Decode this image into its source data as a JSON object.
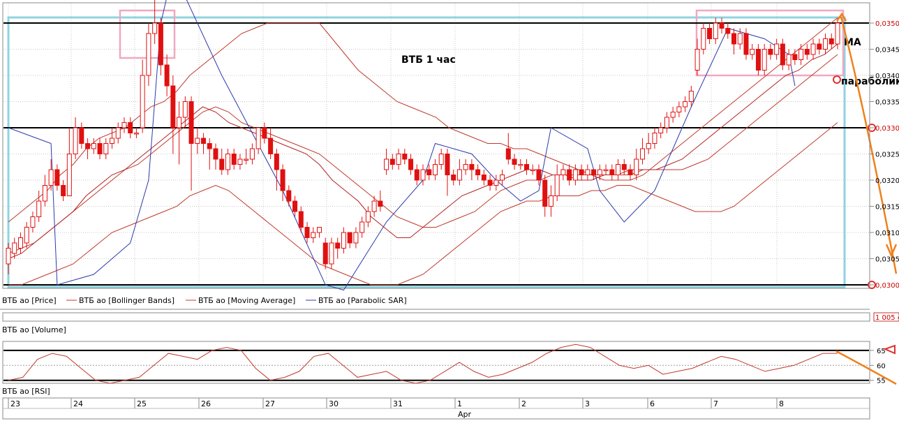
{
  "chart_data": {
    "type": "candlestick",
    "title": "ВТБ   1 час",
    "annotations": {
      "ma": "MA",
      "parabolic": "параболик"
    },
    "x_dates": [
      "23",
      "24",
      "25",
      "26",
      "27",
      "30",
      "31",
      "1",
      "2",
      "3",
      "6",
      "7",
      "8"
    ],
    "x_month_label": "Apr",
    "price_axis": {
      "ylim": [
        0.0298,
        0.0354
      ],
      "ticks": [
        "0,0350",
        "0,0345",
        "0,0340",
        "0,0335",
        "0,0330",
        "0,0325",
        "0,0320",
        "0,0315",
        "0,0310",
        "0,0305",
        "0,0300"
      ],
      "tick_values": [
        0.035,
        0.0345,
        0.034,
        0.0335,
        0.033,
        0.0325,
        0.032,
        0.0315,
        0.031,
        0.0305,
        0.03
      ],
      "horizontal_levels": [
        0.035,
        0.033,
        0.03
      ]
    },
    "legend": [
      "ВТБ ао [Price]",
      "ВТБ ао [Bollinger Bands]",
      "ВТБ ао [Moving Average]",
      "ВТБ ао [Parabolic SAR]"
    ],
    "volume_panel": {
      "label": "ВТБ ао [Volume]",
      "last_value": "1 005 4"
    },
    "rsi_panel": {
      "label": "ВТБ ао [RSI]",
      "ylim": [
        54,
        68
      ],
      "ticks": [
        "65",
        "60",
        "55"
      ],
      "tick_values": [
        65,
        60,
        55
      ],
      "levels": [
        65,
        55
      ]
    },
    "candles": [
      [
        0.0304,
        0.0307,
        0.0302,
        0.0308
      ],
      [
        0.0306,
        0.0308,
        0.0305,
        0.0309
      ],
      [
        0.0307,
        0.0309,
        0.0306,
        0.031
      ],
      [
        0.0308,
        0.0311,
        0.0307,
        0.0312
      ],
      [
        0.0311,
        0.0313,
        0.031,
        0.0314
      ],
      [
        0.0313,
        0.0316,
        0.0312,
        0.0318
      ],
      [
        0.0316,
        0.0319,
        0.0315,
        0.0321
      ],
      [
        0.0319,
        0.0322,
        0.0318,
        0.0324
      ],
      [
        0.0322,
        0.0319,
        0.0318,
        0.0323
      ],
      [
        0.0319,
        0.0317,
        0.0316,
        0.032
      ],
      [
        0.0317,
        0.0325,
        0.0317,
        0.033
      ],
      [
        0.0325,
        0.033,
        0.0324,
        0.0332
      ],
      [
        0.033,
        0.0327,
        0.0326,
        0.0331
      ],
      [
        0.0327,
        0.0326,
        0.0324,
        0.0328
      ],
      [
        0.0326,
        0.0327,
        0.0325,
        0.0328
      ],
      [
        0.0327,
        0.0325,
        0.0324,
        0.0328
      ],
      [
        0.0325,
        0.0327,
        0.0324,
        0.0328
      ],
      [
        0.0327,
        0.0328,
        0.0326,
        0.033
      ],
      [
        0.0328,
        0.033,
        0.0327,
        0.0331
      ],
      [
        0.033,
        0.0331,
        0.0329,
        0.0332
      ],
      [
        0.0331,
        0.0329,
        0.0328,
        0.0332
      ],
      [
        0.0329,
        0.0329,
        0.0328,
        0.033
      ],
      [
        0.033,
        0.034,
        0.0329,
        0.0343
      ],
      [
        0.034,
        0.0348,
        0.0338,
        0.035
      ],
      [
        0.0348,
        0.035,
        0.0346,
        0.0355
      ],
      [
        0.035,
        0.0342,
        0.034,
        0.0351
      ],
      [
        0.0342,
        0.0338,
        0.0336,
        0.0344
      ],
      [
        0.0338,
        0.033,
        0.0325,
        0.034
      ],
      [
        0.033,
        0.0332,
        0.0323,
        0.0335
      ],
      [
        0.0332,
        0.0335,
        0.033,
        0.0336
      ],
      [
        0.0335,
        0.0327,
        0.0318,
        0.0336
      ],
      [
        0.0327,
        0.0328,
        0.0325,
        0.033
      ],
      [
        0.0328,
        0.0327,
        0.0325,
        0.0329
      ],
      [
        0.0327,
        0.0326,
        0.0322,
        0.0328
      ],
      [
        0.0326,
        0.0324,
        0.0322,
        0.0327
      ],
      [
        0.0324,
        0.0322,
        0.0321,
        0.0326
      ],
      [
        0.0322,
        0.0325,
        0.0321,
        0.0326
      ],
      [
        0.0325,
        0.0323,
        0.0322,
        0.0326
      ],
      [
        0.0323,
        0.0324,
        0.0322,
        0.0325
      ],
      [
        0.0324,
        0.0324,
        0.0323,
        0.0326
      ],
      [
        0.0324,
        0.0326,
        0.0323,
        0.0327
      ],
      [
        0.0326,
        0.033,
        0.0325,
        0.033
      ],
      [
        0.033,
        0.0328,
        0.0327,
        0.0331
      ],
      [
        0.0328,
        0.0325,
        0.0324,
        0.033
      ],
      [
        0.0325,
        0.0322,
        0.0318,
        0.0326
      ],
      [
        0.0322,
        0.0318,
        0.0316,
        0.0323
      ],
      [
        0.0318,
        0.0316,
        0.0315,
        0.0319
      ],
      [
        0.0316,
        0.0314,
        0.0313,
        0.0317
      ],
      [
        0.0314,
        0.0311,
        0.031,
        0.0315
      ],
      [
        0.0311,
        0.0309,
        0.0308,
        0.0312
      ],
      [
        0.0309,
        0.031,
        0.0308,
        0.0311
      ],
      [
        0.031,
        0.0311,
        0.0309,
        0.0311
      ],
      [
        0.0308,
        0.0304,
        0.0303,
        0.0309
      ],
      [
        0.0304,
        0.0308,
        0.0303,
        0.0309
      ],
      [
        0.0308,
        0.0307,
        0.0305,
        0.0309
      ],
      [
        0.0307,
        0.031,
        0.0306,
        0.0311
      ],
      [
        0.031,
        0.0308,
        0.0307,
        0.031
      ],
      [
        0.0308,
        0.031,
        0.0307,
        0.0311
      ],
      [
        0.031,
        0.0312,
        0.0309,
        0.0313
      ],
      [
        0.0312,
        0.0314,
        0.0311,
        0.0315
      ],
      [
        0.0314,
        0.0316,
        0.0313,
        0.0317
      ],
      [
        0.0316,
        0.0315,
        0.0314,
        0.0318
      ],
      [
        0.0322,
        0.0324,
        0.0321,
        0.0326
      ],
      [
        0.0324,
        0.0323,
        0.0322,
        0.0325
      ],
      [
        0.0323,
        0.0325,
        0.0322,
        0.0326
      ],
      [
        0.0325,
        0.0324,
        0.0323,
        0.0326
      ],
      [
        0.0324,
        0.0322,
        0.0321,
        0.0325
      ],
      [
        0.0322,
        0.032,
        0.0319,
        0.0323
      ],
      [
        0.032,
        0.0322,
        0.0319,
        0.0323
      ],
      [
        0.0322,
        0.0321,
        0.032,
        0.0323
      ],
      [
        0.0321,
        0.0323,
        0.032,
        0.0324
      ],
      [
        0.0323,
        0.0325,
        0.0322,
        0.0326
      ],
      [
        0.0325,
        0.0321,
        0.0317,
        0.0326
      ],
      [
        0.0321,
        0.032,
        0.0319,
        0.0322
      ],
      [
        0.032,
        0.0322,
        0.0319,
        0.0324
      ],
      [
        0.0322,
        0.0323,
        0.0321,
        0.0324
      ],
      [
        0.0323,
        0.0322,
        0.032,
        0.0324
      ],
      [
        0.0322,
        0.0321,
        0.032,
        0.0323
      ],
      [
        0.0321,
        0.032,
        0.0319,
        0.0322
      ],
      [
        0.032,
        0.0319,
        0.0318,
        0.0321
      ],
      [
        0.0319,
        0.032,
        0.0318,
        0.0321
      ],
      [
        0.032,
        0.0321,
        0.0319,
        0.0322
      ],
      [
        0.0326,
        0.0324,
        0.0323,
        0.0329
      ],
      [
        0.0324,
        0.0323,
        0.0322,
        0.0325
      ],
      [
        0.0323,
        0.0323,
        0.0322,
        0.0324
      ],
      [
        0.0323,
        0.0322,
        0.0321,
        0.0324
      ],
      [
        0.0322,
        0.0322,
        0.0321,
        0.0323
      ],
      [
        0.0322,
        0.032,
        0.0319,
        0.0323
      ],
      [
        0.032,
        0.0315,
        0.0313,
        0.0321
      ],
      [
        0.0315,
        0.0317,
        0.0313,
        0.0319
      ],
      [
        0.0317,
        0.0321,
        0.0316,
        0.0323
      ],
      [
        0.0321,
        0.0322,
        0.032,
        0.0323
      ],
      [
        0.0322,
        0.032,
        0.0319,
        0.0323
      ],
      [
        0.032,
        0.0322,
        0.0319,
        0.0323
      ],
      [
        0.0322,
        0.0321,
        0.032,
        0.0323
      ],
      [
        0.0321,
        0.0322,
        0.032,
        0.0323
      ],
      [
        0.0322,
        0.0321,
        0.032,
        0.0322
      ],
      [
        0.0321,
        0.0322,
        0.032,
        0.0323
      ],
      [
        0.0322,
        0.0322,
        0.0321,
        0.0323
      ],
      [
        0.0322,
        0.0321,
        0.032,
        0.0323
      ],
      [
        0.0321,
        0.0323,
        0.032,
        0.0324
      ],
      [
        0.0323,
        0.0322,
        0.0321,
        0.0324
      ],
      [
        0.0322,
        0.0321,
        0.032,
        0.0323
      ],
      [
        0.0321,
        0.0324,
        0.032,
        0.0326
      ],
      [
        0.0324,
        0.0326,
        0.0323,
        0.0328
      ],
      [
        0.0326,
        0.0327,
        0.0325,
        0.0329
      ],
      [
        0.0327,
        0.0329,
        0.0326,
        0.033
      ],
      [
        0.0329,
        0.033,
        0.0328,
        0.0331
      ],
      [
        0.033,
        0.0332,
        0.0329,
        0.0333
      ],
      [
        0.0332,
        0.0333,
        0.0331,
        0.0334
      ],
      [
        0.0333,
        0.0334,
        0.0332,
        0.0335
      ],
      [
        0.0334,
        0.0335,
        0.0333,
        0.0336
      ],
      [
        0.0335,
        0.0337,
        0.0334,
        0.0338
      ],
      [
        0.0341,
        0.0345,
        0.034,
        0.0347
      ],
      [
        0.0345,
        0.0349,
        0.0344,
        0.035
      ],
      [
        0.0349,
        0.0347,
        0.0346,
        0.035
      ],
      [
        0.0347,
        0.035,
        0.0346,
        0.0351
      ],
      [
        0.035,
        0.0349,
        0.0348,
        0.0351
      ],
      [
        0.0349,
        0.0348,
        0.0347,
        0.035
      ],
      [
        0.0348,
        0.0346,
        0.0344,
        0.0349
      ],
      [
        0.0346,
        0.0348,
        0.0345,
        0.0349
      ],
      [
        0.0348,
        0.0344,
        0.0343,
        0.0349
      ],
      [
        0.0344,
        0.0345,
        0.0343,
        0.0346
      ],
      [
        0.0345,
        0.0341,
        0.034,
        0.0346
      ],
      [
        0.0341,
        0.0345,
        0.034,
        0.0346
      ],
      [
        0.0345,
        0.0344,
        0.0343,
        0.0346
      ],
      [
        0.0344,
        0.0346,
        0.0343,
        0.0347
      ],
      [
        0.0346,
        0.0342,
        0.0341,
        0.0347
      ],
      [
        0.0342,
        0.0344,
        0.0341,
        0.0345
      ],
      [
        0.0344,
        0.0343,
        0.0342,
        0.0345
      ],
      [
        0.0343,
        0.0345,
        0.0342,
        0.0346
      ],
      [
        0.0345,
        0.0344,
        0.0343,
        0.0346
      ],
      [
        0.0344,
        0.0346,
        0.0343,
        0.0347
      ],
      [
        0.0346,
        0.0345,
        0.0344,
        0.0347
      ],
      [
        0.0345,
        0.0347,
        0.0344,
        0.0348
      ],
      [
        0.0347,
        0.0346,
        0.0345,
        0.0348
      ],
      [
        0.0346,
        0.035,
        0.0345,
        0.0351
      ]
    ],
    "bollinger_upper": [
      0.0312,
      0.0314,
      0.0316,
      0.0318,
      0.0321,
      0.0323,
      0.0326,
      0.0328,
      0.0329,
      0.033,
      0.0332,
      0.0334,
      0.0335,
      0.0337,
      0.034,
      0.0342,
      0.0344,
      0.0346,
      0.0348,
      0.0349,
      0.035,
      0.035,
      0.035,
      0.035,
      0.035,
      0.0347,
      0.0344,
      0.0341,
      0.0339,
      0.0337,
      0.0335,
      0.0334,
      0.0333,
      0.0332,
      0.033,
      0.0329,
      0.0328,
      0.0327,
      0.0327,
      0.0326,
      0.0326,
      0.0325,
      0.0324,
      0.0323,
      0.0322,
      0.0321,
      0.032,
      0.032,
      0.032,
      0.0321,
      0.0323,
      0.0325,
      0.0327,
      0.0329,
      0.0331,
      0.0333,
      0.0335,
      0.0337,
      0.0339,
      0.0341,
      0.0343,
      0.0345,
      0.0347,
      0.0349,
      0.0351
    ],
    "bollinger_lower": [
      0.03,
      0.03,
      0.0301,
      0.0302,
      0.0303,
      0.0304,
      0.0306,
      0.0308,
      0.031,
      0.0311,
      0.0312,
      0.0313,
      0.0314,
      0.0315,
      0.0317,
      0.0318,
      0.0319,
      0.0318,
      0.0316,
      0.0314,
      0.0312,
      0.031,
      0.0308,
      0.0306,
      0.0304,
      0.0303,
      0.0302,
      0.0301,
      0.03,
      0.03,
      0.03,
      0.0301,
      0.0302,
      0.0304,
      0.0306,
      0.0308,
      0.031,
      0.0312,
      0.0314,
      0.0315,
      0.0316,
      0.0316,
      0.0317,
      0.0317,
      0.0317,
      0.0318,
      0.0318,
      0.0319,
      0.0319,
      0.0318,
      0.0317,
      0.0316,
      0.0315,
      0.0314,
      0.0314,
      0.0314,
      0.0315,
      0.0317,
      0.0319,
      0.0321,
      0.0323,
      0.0325,
      0.0327,
      0.0329,
      0.0331
    ],
    "bollinger_middle": [
      0.0306,
      0.0307,
      0.0308,
      0.031,
      0.0312,
      0.0314,
      0.0316,
      0.0318,
      0.032,
      0.0322,
      0.0323,
      0.0325,
      0.0327,
      0.0329,
      0.0331,
      0.0333,
      0.0334,
      0.0333,
      0.0331,
      0.033,
      0.0329,
      0.0328,
      0.0327,
      0.0326,
      0.0325,
      0.0323,
      0.0321,
      0.0319,
      0.0317,
      0.0315,
      0.0313,
      0.0312,
      0.0311,
      0.0311,
      0.0312,
      0.0313,
      0.0314,
      0.0316,
      0.0318,
      0.0319,
      0.032,
      0.032,
      0.0321,
      0.0321,
      0.0321,
      0.0321,
      0.0321,
      0.0321,
      0.0321,
      0.0322,
      0.0322,
      0.0322,
      0.0322,
      0.0323,
      0.0324,
      0.0326,
      0.0328,
      0.033,
      0.0332,
      0.0334,
      0.0336,
      0.0338,
      0.034,
      0.0342,
      0.0344
    ],
    "moving_average": [
      0.0305,
      0.0306,
      0.0308,
      0.031,
      0.0312,
      0.0314,
      0.0317,
      0.0319,
      0.0321,
      0.0322,
      0.0324,
      0.0326,
      0.0328,
      0.033,
      0.0332,
      0.0334,
      0.0333,
      0.0331,
      0.033,
      0.0329,
      0.0328,
      0.0327,
      0.0326,
      0.0325,
      0.0323,
      0.032,
      0.0318,
      0.0316,
      0.0313,
      0.0311,
      0.0309,
      0.0309,
      0.0311,
      0.0313,
      0.0315,
      0.0317,
      0.0318,
      0.0319,
      0.032,
      0.0321,
      0.0322,
      0.0322,
      0.0321,
      0.0321,
      0.032,
      0.032,
      0.0321,
      0.0321,
      0.0322,
      0.0322,
      0.0322,
      0.0323,
      0.0324,
      0.0326,
      0.0328,
      0.033,
      0.0332,
      0.0334,
      0.0336,
      0.0338,
      0.034,
      0.0341,
      0.0343,
      0.0344,
      0.0346
    ],
    "parabolic_sar": [
      [
        0,
        0.033
      ],
      [
        7,
        0.0327
      ],
      [
        8,
        0.03
      ],
      [
        14,
        0.0302
      ],
      [
        20,
        0.0308
      ],
      [
        23,
        0.032
      ],
      [
        25,
        0.035
      ],
      [
        27,
        0.036
      ],
      [
        35,
        0.034
      ],
      [
        45,
        0.0318
      ],
      [
        52,
        0.03
      ],
      [
        55,
        0.0299
      ],
      [
        62,
        0.0312
      ],
      [
        68,
        0.032
      ],
      [
        70,
        0.0327
      ],
      [
        76,
        0.0325
      ],
      [
        80,
        0.032
      ],
      [
        84,
        0.0316
      ],
      [
        87,
        0.0318
      ],
      [
        89,
        0.033
      ],
      [
        95,
        0.0326
      ],
      [
        97,
        0.0318
      ],
      [
        101,
        0.0312
      ],
      [
        106,
        0.0318
      ],
      [
        112,
        0.0334
      ],
      [
        118,
        0.0349
      ],
      [
        124,
        0.0347
      ],
      [
        128,
        0.0344
      ],
      [
        129,
        0.0338
      ]
    ],
    "rsi_values": [
      55,
      56,
      62,
      64,
      63,
      59,
      55,
      54,
      55,
      56,
      60,
      64,
      63,
      62,
      65,
      66,
      65,
      59,
      55,
      56,
      58,
      63,
      64,
      60,
      56,
      57,
      58,
      55,
      54,
      55,
      58,
      61,
      58,
      56,
      57,
      59,
      61,
      64,
      66,
      67,
      66,
      63,
      60,
      59,
      60,
      57,
      58,
      59,
      61,
      63,
      62,
      60,
      58,
      59,
      60,
      62,
      64,
      64
    ]
  }
}
